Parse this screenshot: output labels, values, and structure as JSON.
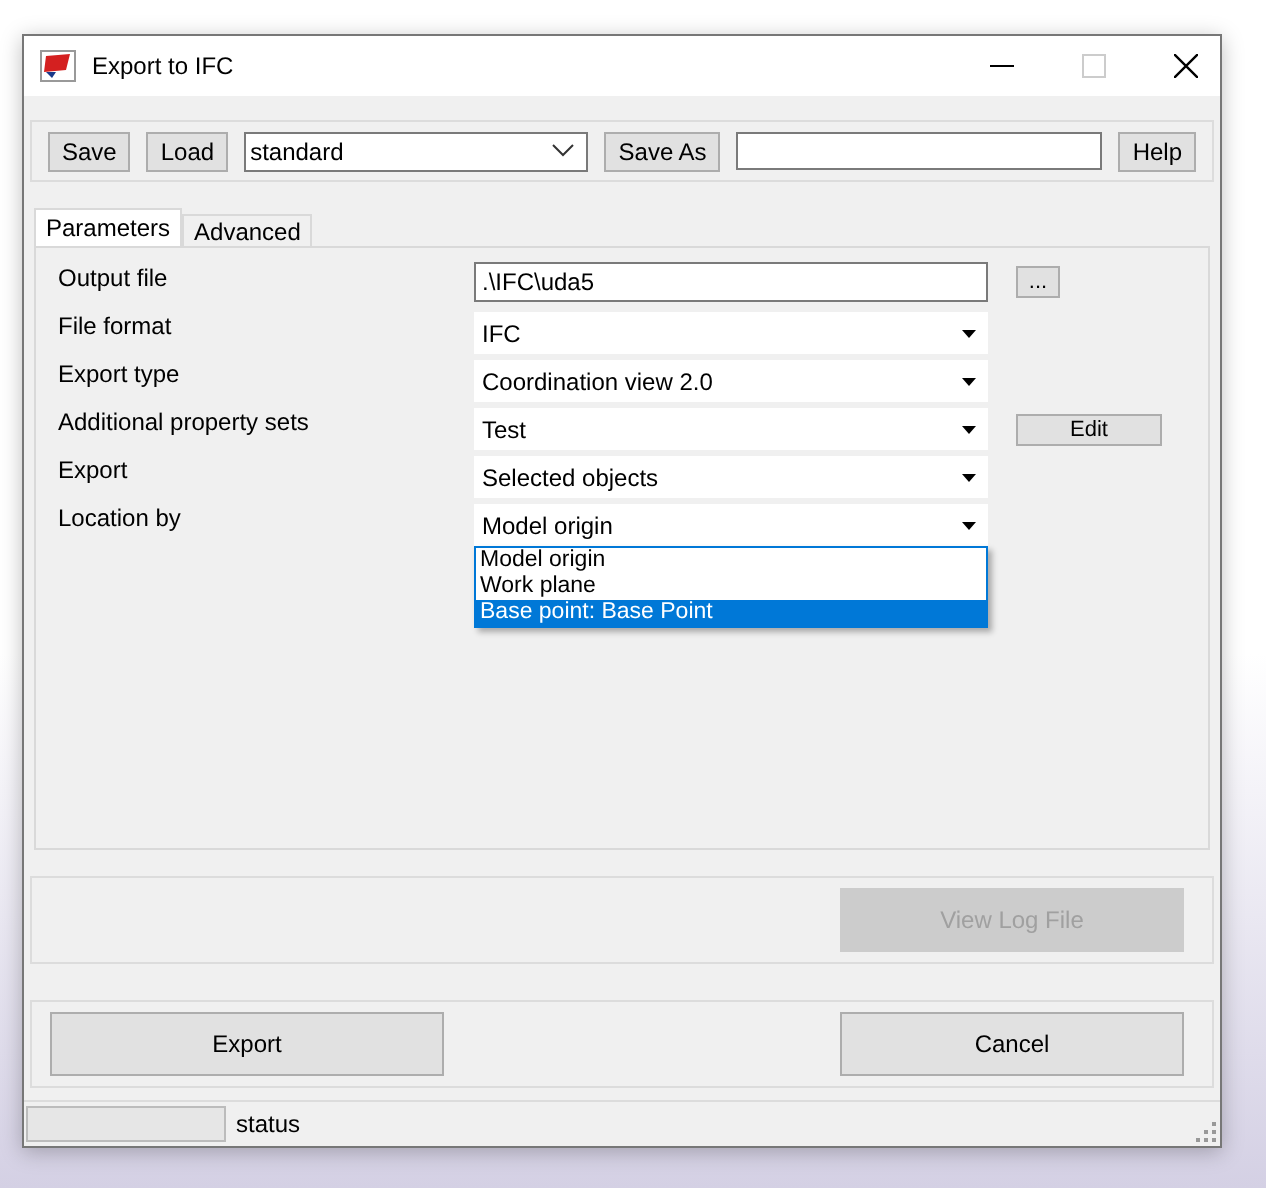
{
  "window": {
    "title": "Export to IFC"
  },
  "toolbar": {
    "save": "Save",
    "load": "Load",
    "preset": "standard",
    "save_as": "Save As",
    "help": "Help"
  },
  "tabs": [
    {
      "label": "Parameters",
      "selected": true
    },
    {
      "label": "Advanced",
      "selected": false
    }
  ],
  "rows": [
    {
      "label": "Output file",
      "kind": "text",
      "value": ".\\IFC\\uda5",
      "button": "..."
    },
    {
      "label": "File format",
      "kind": "combo",
      "value": "IFC",
      "expanded": false
    },
    {
      "label": "Export type",
      "kind": "combo",
      "value": "Coordination view 2.0",
      "expanded": false
    },
    {
      "label": "Additional property sets",
      "kind": "combo",
      "value": "Test",
      "button": "Edit",
      "expanded": false
    },
    {
      "label": "Export",
      "kind": "combo",
      "value": "Selected objects",
      "expanded": false
    },
    {
      "label": "Location by",
      "kind": "combo",
      "value": "Model origin",
      "expanded": true
    }
  ],
  "dropdown_options": [
    {
      "label": "Model origin",
      "selected": false
    },
    {
      "label": "Work plane",
      "selected": false
    },
    {
      "label": "Base point: Base Point",
      "selected": true
    }
  ],
  "view_log": {
    "label": "View Log File",
    "disabled": true
  },
  "actions": {
    "export": "Export",
    "cancel": "Cancel"
  },
  "status_bar": {
    "progress": {
      "level": 0
    },
    "text": "status"
  }
}
